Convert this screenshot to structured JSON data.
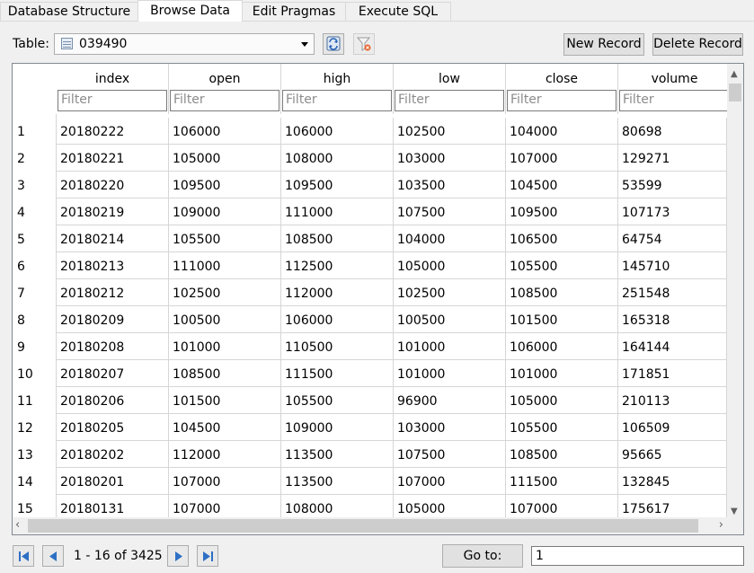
{
  "tabs": [
    {
      "label": "Database Structure",
      "active": false
    },
    {
      "label": "Browse Data",
      "active": true
    },
    {
      "label": "Edit Pragmas",
      "active": false
    },
    {
      "label": "Execute SQL",
      "active": false
    }
  ],
  "toolbar": {
    "table_label": "Table:",
    "table_value": "039490",
    "new_record": "New Record",
    "delete_record": "Delete Record"
  },
  "columns": [
    "index",
    "open",
    "high",
    "low",
    "close",
    "volume"
  ],
  "filter_placeholder": "Filter",
  "rows": [
    {
      "num": "1",
      "cells": [
        "20180222",
        "106000",
        "106000",
        "102500",
        "104000",
        "80698"
      ]
    },
    {
      "num": "2",
      "cells": [
        "20180221",
        "105000",
        "108000",
        "103000",
        "107000",
        "129271"
      ]
    },
    {
      "num": "3",
      "cells": [
        "20180220",
        "109500",
        "109500",
        "103500",
        "104500",
        "53599"
      ]
    },
    {
      "num": "4",
      "cells": [
        "20180219",
        "109000",
        "111000",
        "107500",
        "109500",
        "107173"
      ]
    },
    {
      "num": "5",
      "cells": [
        "20180214",
        "105500",
        "108500",
        "104000",
        "106500",
        "64754"
      ]
    },
    {
      "num": "6",
      "cells": [
        "20180213",
        "111000",
        "112500",
        "105000",
        "105500",
        "145710"
      ]
    },
    {
      "num": "7",
      "cells": [
        "20180212",
        "102500",
        "112000",
        "102500",
        "108500",
        "251548"
      ]
    },
    {
      "num": "8",
      "cells": [
        "20180209",
        "100500",
        "106000",
        "100500",
        "101500",
        "165318"
      ]
    },
    {
      "num": "9",
      "cells": [
        "20180208",
        "101000",
        "110500",
        "101000",
        "106000",
        "164144"
      ]
    },
    {
      "num": "10",
      "cells": [
        "20180207",
        "108500",
        "111500",
        "101000",
        "101000",
        "171851"
      ]
    },
    {
      "num": "11",
      "cells": [
        "20180206",
        "101500",
        "105500",
        "96900",
        "105000",
        "210113"
      ]
    },
    {
      "num": "12",
      "cells": [
        "20180205",
        "104500",
        "109000",
        "103000",
        "105500",
        "106509"
      ]
    },
    {
      "num": "13",
      "cells": [
        "20180202",
        "112000",
        "113500",
        "107500",
        "108500",
        "95665"
      ]
    },
    {
      "num": "14",
      "cells": [
        "20180201",
        "107000",
        "113500",
        "107000",
        "111500",
        "132845"
      ]
    },
    {
      "num": "15",
      "cells": [
        "20180131",
        "107000",
        "108000",
        "105000",
        "107000",
        "175617"
      ]
    }
  ],
  "nav": {
    "range": "1 - 16 of 3425",
    "goto_label": "Go to:",
    "goto_value": "1"
  },
  "icons": {
    "table": "table-icon",
    "refresh": "refresh-icon",
    "clear_filters": "clear-filter-icon",
    "first": "first-page-icon",
    "prev": "prev-page-icon",
    "next": "next-page-icon",
    "last": "last-page-icon"
  }
}
